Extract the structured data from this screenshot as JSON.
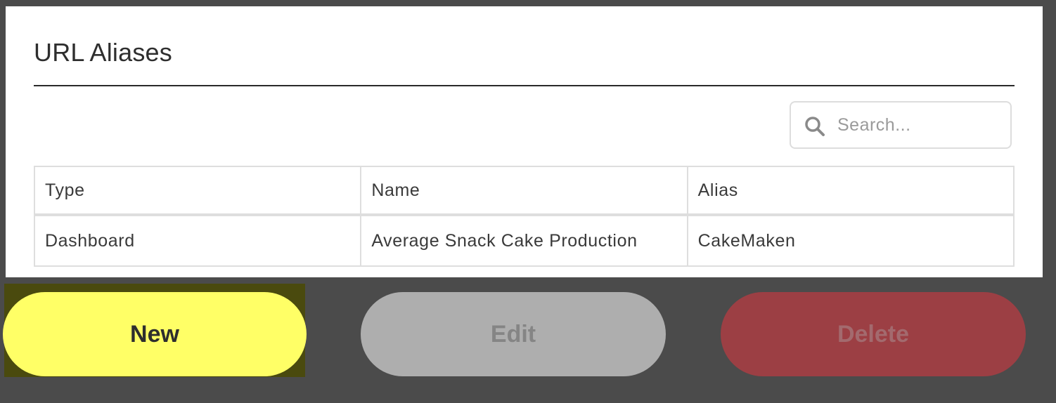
{
  "dialog": {
    "title": "URL Aliases"
  },
  "search": {
    "placeholder": "Search..."
  },
  "table": {
    "columns": [
      "Type",
      "Name",
      "Alias"
    ],
    "rows": [
      [
        "Dashboard",
        "Average Snack Cake Production",
        "CakeMaken"
      ]
    ]
  },
  "actions": {
    "new_label": "New",
    "edit_label": "Edit",
    "delete_label": "Delete"
  },
  "colors": {
    "new_button": "#ffff66",
    "edit_button_disabled": "#aeaeae",
    "delete_button_disabled": "#9c3f44",
    "backdrop": "#4b4b4b"
  },
  "icons": {
    "search": "search-icon"
  }
}
